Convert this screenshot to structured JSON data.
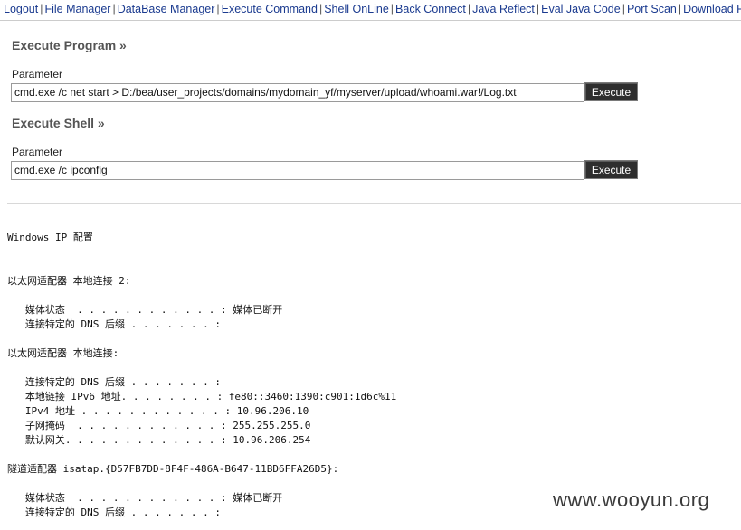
{
  "nav": {
    "links": [
      "Logout",
      "File Manager",
      "DataBase Manager",
      "Execute Command",
      "Shell OnLine",
      "Back Connect",
      "Java Reflect",
      "Eval Java Code",
      "Port Scan",
      "Download R"
    ],
    "separator": "|",
    "link_color": "#1a3a8f"
  },
  "execute_program": {
    "title": "Execute Program »",
    "param_label": "Parameter",
    "param_value": "cmd.exe /c net start > D:/bea/user_projects/domains/mydomain_yf/myserver/upload/whoami.war!/Log.txt",
    "button_label": "Execute"
  },
  "execute_shell": {
    "title": "Execute Shell »",
    "param_label": "Parameter",
    "param_value": "cmd.exe /c ipconfig",
    "button_label": "Execute"
  },
  "output_lines": [
    "Windows IP 配置",
    "",
    "",
    "以太网适配器 本地连接 2:",
    "",
    "   媒体状态  . . . . . . . . . . . . : 媒体已断开",
    "   连接特定的 DNS 后缀 . . . . . . . :",
    "",
    "以太网适配器 本地连接:",
    "",
    "   连接特定的 DNS 后缀 . . . . . . . :",
    "   本地链接 IPv6 地址. . . . . . . . : fe80::3460:1390:c901:1d6c%11",
    "   IPv4 地址 . . . . . . . . . . . . : 10.96.206.10",
    "   子网掩码  . . . . . . . . . . . . : 255.255.255.0",
    "   默认网关. . . . . . . . . . . . . : 10.96.206.254",
    "",
    "隧道适配器 isatap.{D57FB7DD-8F4F-486A-B647-11BD6FFA26D5}:",
    "",
    "   媒体状态  . . . . . . . . . . . . : 媒体已断开",
    "   连接特定的 DNS 后缀 . . . . . . . :"
  ],
  "watermark": "www.wooyun.org",
  "colors": {
    "button_bg": "#2e2e2e",
    "section_title": "#555555"
  }
}
